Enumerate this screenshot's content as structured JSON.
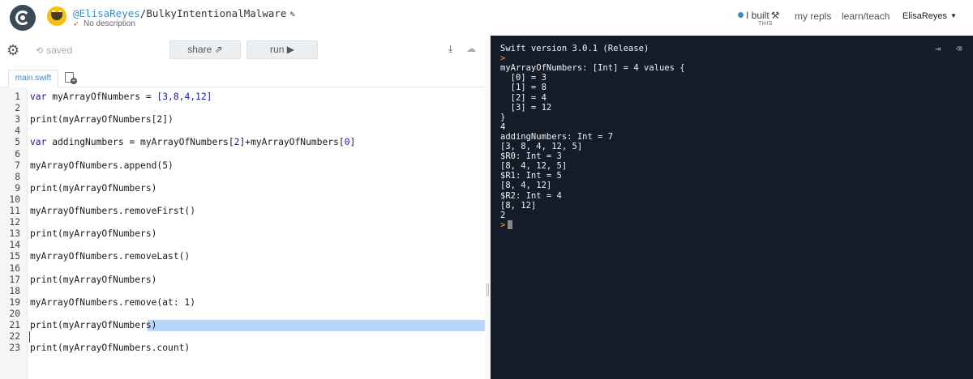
{
  "header": {
    "owner": "@ElisaReyes",
    "separator": "/",
    "repl_name": "BulkyIntentionalMalware",
    "description": "No description",
    "ibuilt_label": "I built",
    "ibuilt_sub": "THIS",
    "nav": [
      "my repls",
      "learn/teach"
    ],
    "username": "ElisaReyes"
  },
  "toolbar": {
    "saved_label": "saved",
    "share_label": "share",
    "run_label": "run"
  },
  "tabs": [
    {
      "label": "main.swift"
    }
  ],
  "code_lines": [
    {
      "n": "1",
      "text": ""
    },
    {
      "n": "2",
      "text": ""
    },
    {
      "n": "3",
      "text": "print(myArrayOfNumbers[2])"
    },
    {
      "n": "4",
      "text": ""
    },
    {
      "n": "5",
      "text": ""
    },
    {
      "n": "6",
      "text": ""
    },
    {
      "n": "7",
      "text": "myArrayOfNumbers.append(5)"
    },
    {
      "n": "8",
      "text": ""
    },
    {
      "n": "9",
      "text": "print(myArrayOfNumbers)"
    },
    {
      "n": "10",
      "text": ""
    },
    {
      "n": "11",
      "text": "myArrayOfNumbers.removeFirst()"
    },
    {
      "n": "12",
      "text": ""
    },
    {
      "n": "13",
      "text": "print(myArrayOfNumbers)"
    },
    {
      "n": "14",
      "text": ""
    },
    {
      "n": "15",
      "text": "myArrayOfNumbers.removeLast()"
    },
    {
      "n": "16",
      "text": ""
    },
    {
      "n": "17",
      "text": "print(myArrayOfNumbers)"
    },
    {
      "n": "18",
      "text": ""
    },
    {
      "n": "19",
      "text": "myArrayOfNumbers.remove(at: 1)"
    },
    {
      "n": "20",
      "text": ""
    },
    {
      "n": "21",
      "text": "print(myArrayOfNumbers)"
    },
    {
      "n": "22",
      "text": ""
    },
    {
      "n": "23",
      "text": "print(myArrayOfNumbers.count)"
    }
  ],
  "code_rich": {
    "line1": {
      "kw": "var",
      "name": " myArrayOfNumbers = ",
      "value": "[3,8,4,12]"
    },
    "line5": {
      "kw": "var",
      "name": " addingNumbers = myArrayOfNumbers[",
      "i1": "2",
      "mid": "]+myArrayOfNumbers[",
      "i2": "0",
      "end": "]"
    }
  },
  "console_lines": [
    "Swift version 3.0.1 (Release)",
    ">",
    "myArrayOfNumbers: [Int] = 4 values {",
    "  [0] = 3",
    "  [1] = 8",
    "  [2] = 4",
    "  [3] = 12",
    "}",
    "4",
    "addingNumbers: Int = 7",
    "[3, 8, 4, 12, 5]",
    "$R0: Int = 3",
    "[8, 4, 12, 5]",
    "$R1: Int = 5",
    "[8, 4, 12]",
    "$R2: Int = 4",
    "[8, 12]",
    "2",
    ">"
  ],
  "colors": {
    "console_bg": "#141c2a",
    "accent": "#3a8cc1",
    "prompt": "#f5a623",
    "selection": "#b8d6fb"
  },
  "icons": [
    "replit-logo-icon",
    "avatar-icon",
    "pencil-icon",
    "swift-icon",
    "hammer-icon",
    "gear-icon",
    "history-icon",
    "share-icon",
    "play-icon",
    "download-icon",
    "cloud-icon",
    "new-file-icon",
    "exit-icon",
    "clear-console-icon"
  ]
}
